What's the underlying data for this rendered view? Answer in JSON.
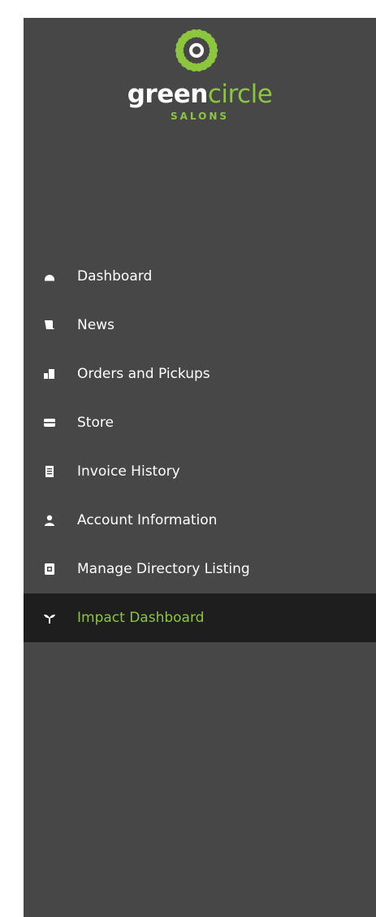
{
  "brand": {
    "word_bold": "green",
    "word_light": "circle",
    "subtitle": "SALONS",
    "colors": {
      "accent": "#8cc63f",
      "sidebar_bg": "#474747",
      "active_bg": "#1e1e1e",
      "text": "#ffffff"
    }
  },
  "nav": {
    "items": [
      {
        "label": "Dashboard",
        "icon": "dashboard-icon",
        "active": false
      },
      {
        "label": "News",
        "icon": "news-icon",
        "active": false
      },
      {
        "label": "Orders and Pickups",
        "icon": "orders-icon",
        "active": false
      },
      {
        "label": "Store",
        "icon": "store-icon",
        "active": false
      },
      {
        "label": "Invoice History",
        "icon": "invoice-icon",
        "active": false
      },
      {
        "label": "Account Information",
        "icon": "user-icon",
        "active": false
      },
      {
        "label": "Manage Directory Listing",
        "icon": "directory-icon",
        "active": false
      },
      {
        "label": "Impact Dashboard",
        "icon": "sprout-icon",
        "active": true
      }
    ]
  }
}
